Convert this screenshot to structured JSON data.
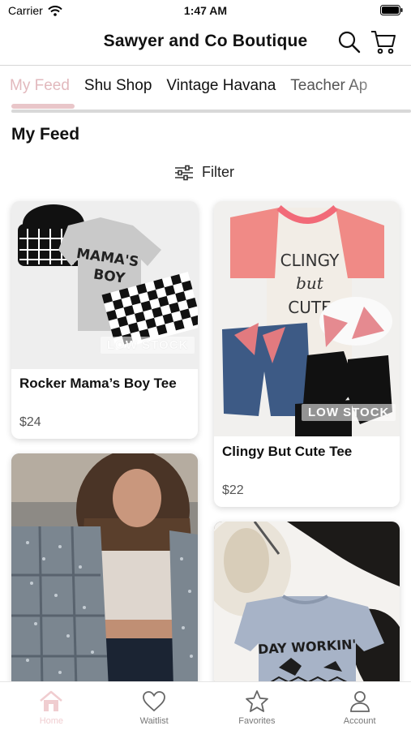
{
  "status_bar": {
    "carrier": "Carrier",
    "time": "1:47 AM"
  },
  "header": {
    "title": "Sawyer and Co Boutique",
    "search_icon": "search-icon",
    "cart_icon": "cart-icon"
  },
  "tabs": [
    {
      "label": "My Feed",
      "active": true
    },
    {
      "label": "Shu Shop",
      "active": false
    },
    {
      "label": "Vintage Havana",
      "active": false
    },
    {
      "label": "Teacher Ap",
      "active": false
    }
  ],
  "feed": {
    "heading": "My Feed",
    "filter_label": "Filter",
    "products": [
      {
        "name": "Rocker Mama’s Boy Tee",
        "price": "$24",
        "badge": "LOW STOCK",
        "print": [
          "MAMA'S",
          "BOY"
        ]
      },
      {
        "name": "Clingy But Cute Tee",
        "price": "$22",
        "badge": "LOW STOCK",
        "print": [
          "CLINGY",
          "but",
          "CUTE"
        ]
      },
      {
        "name": "",
        "price": "",
        "badge": ""
      },
      {
        "name": "",
        "price": "",
        "badge": "",
        "print": [
          "DAY WORKIN'"
        ]
      }
    ]
  },
  "bottom_nav": [
    {
      "label": "Home",
      "icon": "home-icon",
      "active": true
    },
    {
      "label": "Waitlist",
      "icon": "heart-icon",
      "active": false
    },
    {
      "label": "Favorites",
      "icon": "star-icon",
      "active": false
    },
    {
      "label": "Account",
      "icon": "person-icon",
      "active": false
    }
  ],
  "colors": {
    "accent": "#e9c6c9",
    "active_tab_text": "#e2b9bd",
    "card_shadow": "#d0d0d0"
  }
}
